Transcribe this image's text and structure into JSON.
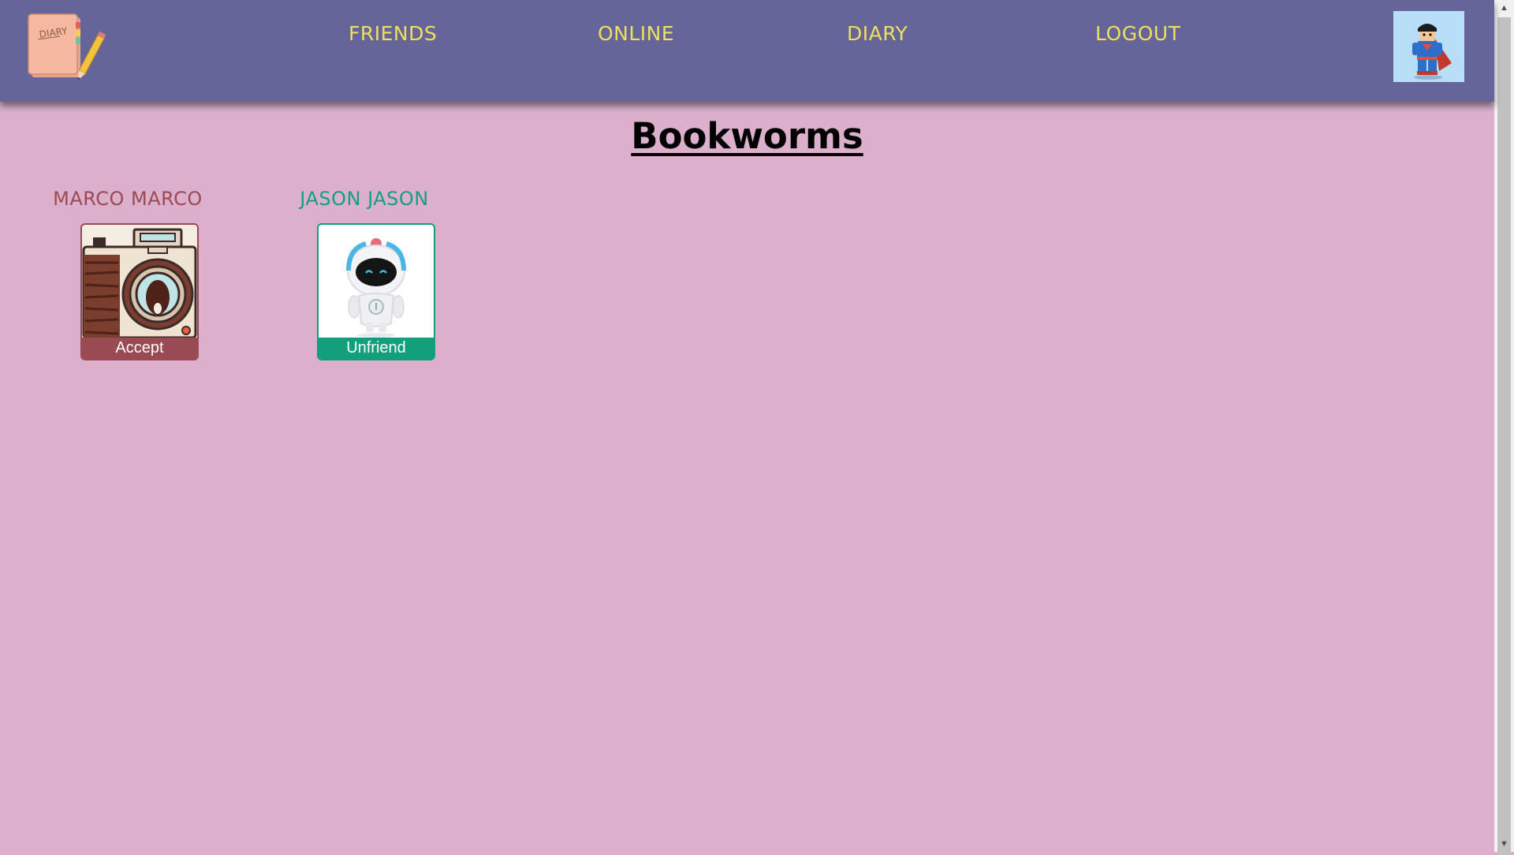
{
  "nav": {
    "logo_text": "DIARY",
    "links": [
      {
        "label": "FRIENDS"
      },
      {
        "label": "ONLINE"
      },
      {
        "label": "DIARY"
      },
      {
        "label": "LOGOUT"
      }
    ],
    "avatar_icon": "superhero-avatar-icon",
    "link_color": "#efdf5e",
    "background_color": "#656599"
  },
  "page": {
    "title": "Bookworms",
    "background_color": "#dcb0cd"
  },
  "friends": [
    {
      "name": "MARCO MARCO",
      "action": "Accept",
      "photo_icon": "camera-icon",
      "color": "#9a4a52"
    },
    {
      "name": "JASON JASON",
      "action": "Unfriend",
      "photo_icon": "robot-icon",
      "color": "#12a07c"
    }
  ]
}
